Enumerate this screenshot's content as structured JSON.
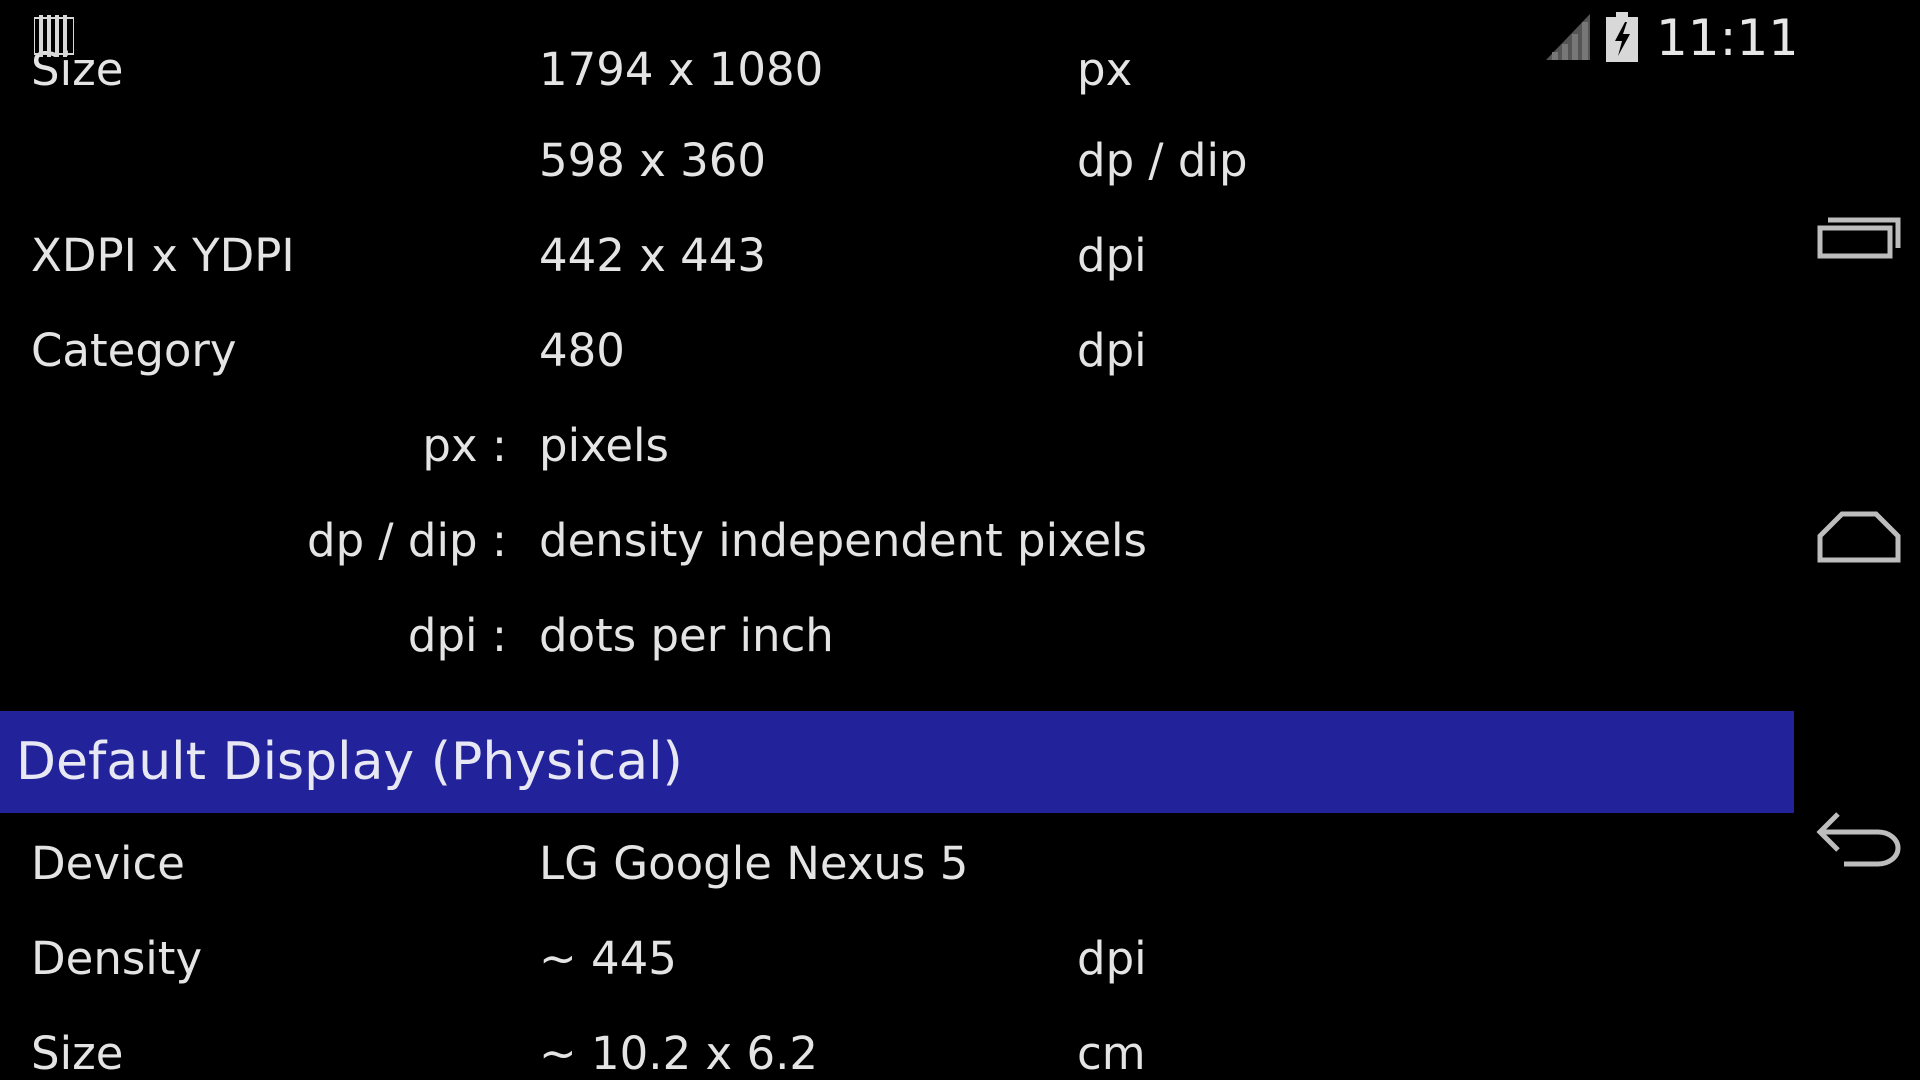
{
  "status_bar": {
    "notification_icon": "barcode-notification-icon",
    "signal_icon": "cell-signal-icon",
    "battery_icon": "battery-charging-icon",
    "time": "11:11"
  },
  "rows_top": [
    {
      "label": "Size",
      "value": "1794 x 1080",
      "unit": "px"
    },
    {
      "label": "",
      "value": "598 x 360",
      "unit": "dp / dip"
    },
    {
      "label": "XDPI x YDPI",
      "value": "442 x 443",
      "unit": "dpi"
    },
    {
      "label": "Category",
      "value": "480",
      "unit": "dpi"
    }
  ],
  "legend": [
    {
      "key": "px :",
      "desc": "pixels"
    },
    {
      "key": "dp / dip :",
      "desc": "density independent pixels"
    },
    {
      "key": "dpi :",
      "desc": "dots per inch"
    }
  ],
  "section": {
    "title": "Default Display (Physical)"
  },
  "rows_physical": [
    {
      "label": "Device",
      "value": "LG Google Nexus 5",
      "unit": ""
    },
    {
      "label": "Density",
      "value": "~ 445",
      "unit": "dpi"
    },
    {
      "label": "Size",
      "value": "~ 10.2 x 6.2",
      "unit": "cm"
    }
  ],
  "nav": {
    "recents_icon": "recent-apps-icon",
    "home_icon": "home-icon",
    "back_icon": "back-icon"
  },
  "colors": {
    "background": "#000000",
    "section_header": "#22239a",
    "text": "#e4e4e4"
  }
}
